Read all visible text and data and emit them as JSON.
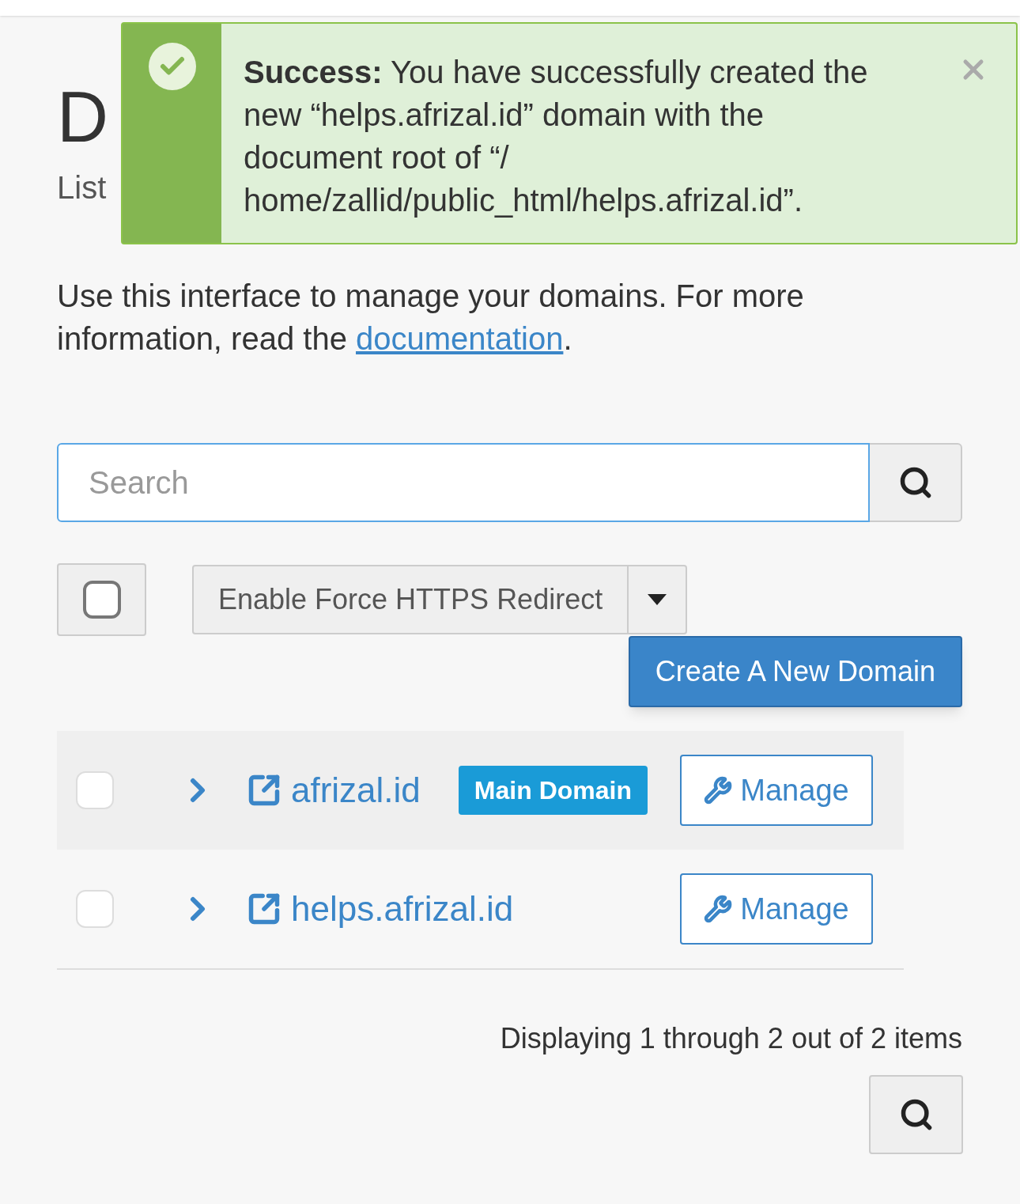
{
  "header": {
    "title": "D",
    "subtitle": "List"
  },
  "alert": {
    "kind": "success",
    "message": "**Success:** You have successfully created the new “helps.afrizal.id” domain with the document root of “/ home/zallid/public_html/helps.afrizal.id”."
  },
  "intro": {
    "text": "Use this interface to manage your domains. For more information, read the ",
    "link": "documentation",
    "after": "."
  },
  "search": {
    "placeholder": "Search"
  },
  "select_all": {
    "checked": false
  },
  "bulk_action": {
    "label": "Enable Force HTTPS Redirect"
  },
  "create_button": "Create A New Domain",
  "domains": [
    {
      "name": "afrizal.id",
      "badge": "Main Domain",
      "checked": false,
      "expanded": false,
      "action": "Manage"
    },
    {
      "name": "helps.afrizal.id",
      "checked": false,
      "expanded": false,
      "action": "Manage"
    }
  ],
  "pagination": {
    "summary": "Displaying 1 through 2 out of 2 items"
  }
}
